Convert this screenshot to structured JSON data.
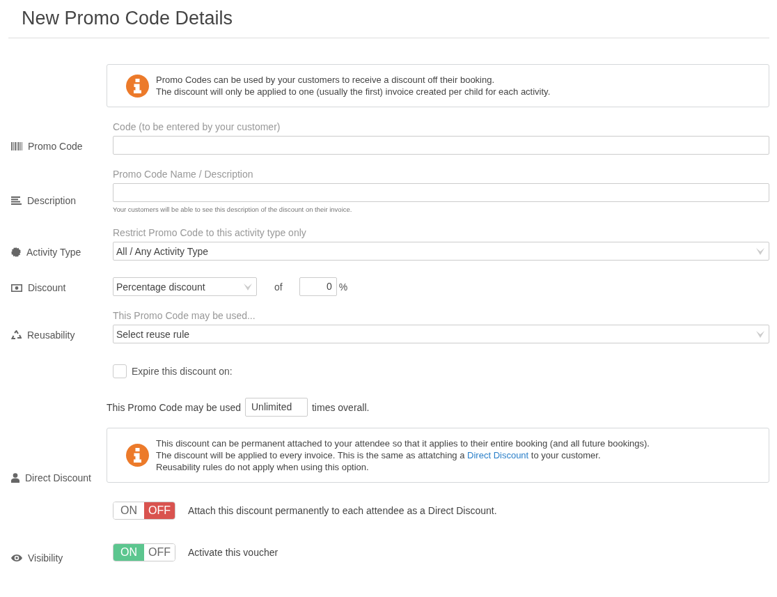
{
  "title": "New Promo Code Details",
  "rows": [
    {
      "kind": "info",
      "lines": [
        [
          {
            "text": "Promo Codes can be used by your customers to receive a discount off their booking.",
            "kind": "text"
          }
        ],
        [
          {
            "text": "The discount will only be applied to one (usually the first) invoice created per child for each activity.",
            "kind": "text"
          }
        ]
      ]
    },
    {
      "kind": "text",
      "label": "Promo Code",
      "caption": "Code (to be entered by your customer)"
    },
    {
      "kind": "text",
      "label": "Description",
      "caption": "Promo Code Name / Description",
      "help": "Your customers will be able to see this description of the discount on their invoice."
    },
    {
      "kind": "select",
      "label": "Activity Type",
      "caption": "Restrict Promo Code to this activity type only",
      "value": "All / Any Activity Type"
    },
    {
      "kind": "discount",
      "label": "Discount",
      "value": "Percentage discount",
      "of": "of",
      "amount": "0",
      "unit": "%"
    },
    {
      "kind": "select",
      "label": "Reusability",
      "caption": "This Promo Code may be used...",
      "value": "Select reuse rule"
    },
    {
      "kind": "checkbox",
      "checked": false,
      "text": "Expire this discount on:"
    },
    {
      "kind": "usage",
      "before": "This Promo Code may be used",
      "value": "Unlimited",
      "after": "times overall."
    },
    {
      "kind": "info",
      "label": "Direct Discount",
      "lines": [
        [
          {
            "text": "This discount can be permanent attached to your attendee so that it applies to their entire booking (and all future bookings).",
            "kind": "text"
          }
        ],
        [
          {
            "text": "The discount will be applied to every invoice. This is the same as attatching a",
            "kind": "text"
          },
          {
            "text": "Direct Discount",
            "kind": "link"
          },
          {
            "text": "to your customer.",
            "kind": "text"
          }
        ],
        [
          {
            "text": "Reusability rules do not apply when using this option.",
            "kind": "text"
          }
        ]
      ]
    },
    {
      "kind": "toggle",
      "on": false,
      "on_label": "ON",
      "off_label": "OFF",
      "text": "Attach this discount permanently to each attendee as a Direct Discount."
    },
    {
      "kind": "toggle",
      "label": "Visibility",
      "on": true,
      "on_label": "ON",
      "off_label": "OFF",
      "text": "Activate this voucher"
    }
  ]
}
